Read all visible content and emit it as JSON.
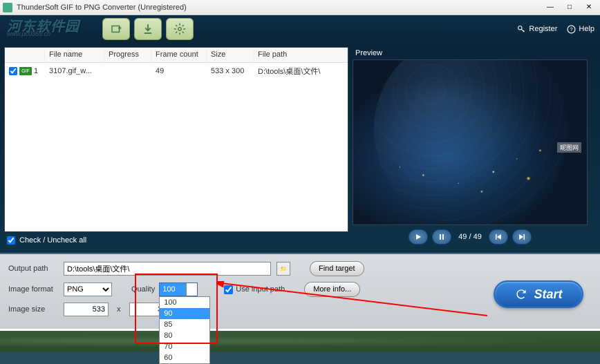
{
  "window": {
    "title": "ThunderSoft GIF to PNG Converter (Unregistered)"
  },
  "watermark": {
    "text": "河东软件园",
    "url": "www.pc0359.cn"
  },
  "toolbar": {
    "register_label": "Register",
    "help_label": "Help"
  },
  "table": {
    "headers": {
      "filename": "File name",
      "progress": "Progress",
      "framecount": "Frame count",
      "size": "Size",
      "filepath": "File path"
    },
    "rows": [
      {
        "index": "1",
        "icon": "GIF",
        "name": "3107.gif_w...",
        "progress": "",
        "framecount": "49",
        "size": "533 x 300",
        "path": "D:\\tools\\桌面\\文件\\"
      }
    ],
    "check_all_label": "Check / Uncheck all"
  },
  "preview": {
    "label": "Preview",
    "watermark": "昵图网",
    "frame_position": "49 / 49"
  },
  "settings": {
    "output_path_label": "Output path",
    "output_path_value": "D:\\tools\\桌面\\文件\\",
    "image_format_label": "Image format",
    "image_format_value": "PNG",
    "quality_label": "Quality",
    "quality_value": "100",
    "quality_options": [
      "100",
      "90",
      "85",
      "80",
      "70",
      "60"
    ],
    "image_size_label": "Image size",
    "image_width": "533",
    "image_height": "300",
    "use_input_path_label": "Use input path",
    "find_target_label": "Find target",
    "more_info_label": "More info...",
    "start_label": "Start"
  }
}
